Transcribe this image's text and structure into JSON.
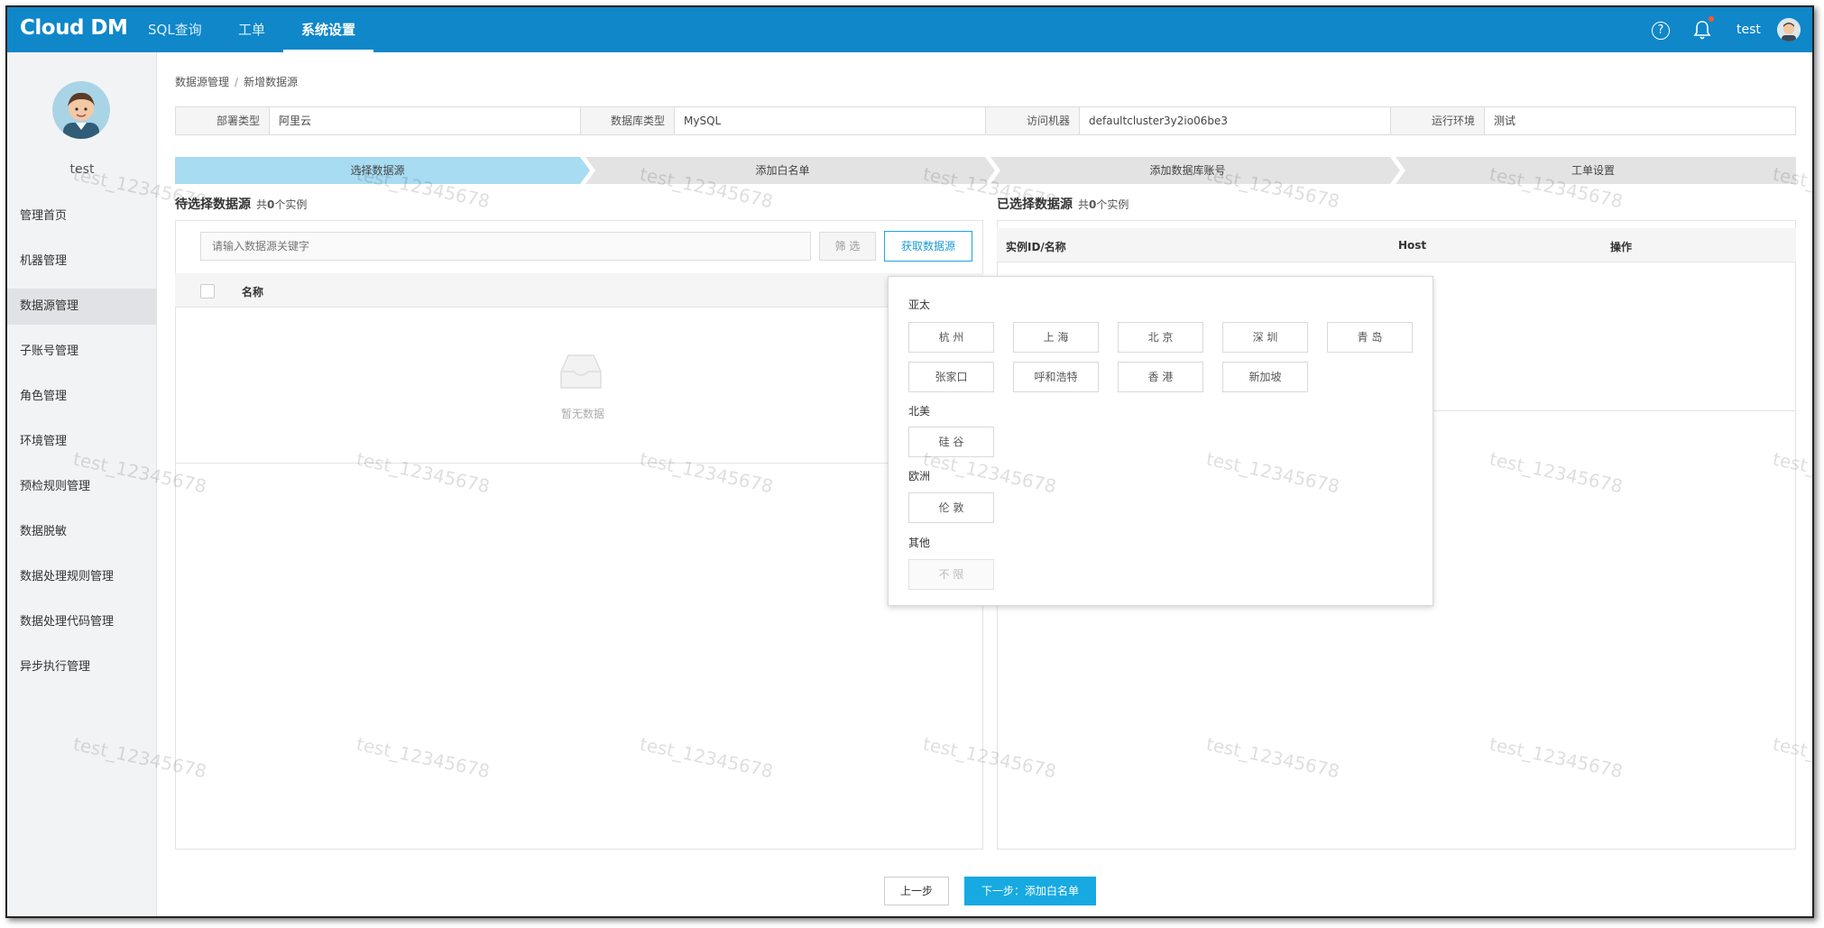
{
  "header": {
    "logo": "Cloud DM",
    "nav": [
      "SQL查询",
      "工单",
      "系统设置"
    ],
    "user": "test"
  },
  "sidebar": {
    "user": "test",
    "items": [
      "管理首页",
      "机器管理",
      "数据源管理",
      "子账号管理",
      "角色管理",
      "环境管理",
      "预检规则管理",
      "数据脱敏",
      "数据处理规则管理",
      "数据处理代码管理",
      "异步执行管理"
    ],
    "active_index": 2
  },
  "breadcrumb": {
    "parent": "数据源管理",
    "separator": "/",
    "current": "新增数据源"
  },
  "info": [
    {
      "label": "部署类型",
      "value": "阿里云"
    },
    {
      "label": "数据库类型",
      "value": "MySQL"
    },
    {
      "label": "访问机器",
      "value": "defaultcluster3y2io06be3"
    },
    {
      "label": "运行环境",
      "value": "测试"
    }
  ],
  "steps": [
    "选择数据源",
    "添加白名单",
    "添加数据库账号",
    "工单设置"
  ],
  "left": {
    "title": "待选择数据源",
    "count_prefix": "共",
    "count": "0",
    "count_suffix": "个实例",
    "search_placeholder": "请输入数据源关键字",
    "filter_label": "筛 选",
    "fetch_label": "获取数据源",
    "col_name": "名称",
    "empty_text": "暂无数据"
  },
  "right": {
    "title": "已选择数据源",
    "count_prefix": "共",
    "count": "0",
    "count_suffix": "个实例",
    "cols": [
      "实例ID/名称",
      "Host",
      "操作"
    ]
  },
  "regions": {
    "asia": {
      "label": "亚太",
      "cities": [
        "杭 州",
        "上 海",
        "北 京",
        "深 圳",
        "青 岛",
        "张家口",
        "呼和浩特",
        "香 港",
        "新加坡"
      ]
    },
    "na": {
      "label": "北美",
      "cities": [
        "硅 谷"
      ]
    },
    "eu": {
      "label": "欧洲",
      "cities": [
        "伦 敦"
      ]
    },
    "other": {
      "label": "其他",
      "cities": [
        "不 限"
      ]
    }
  },
  "footer": {
    "prev": "上一步",
    "next": "下一步：添加白名单"
  },
  "watermark": "test_12345678",
  "colors": {
    "topbar": "#0f87c9",
    "accent": "#17a9e1",
    "active_step": "#a8dcf2"
  }
}
